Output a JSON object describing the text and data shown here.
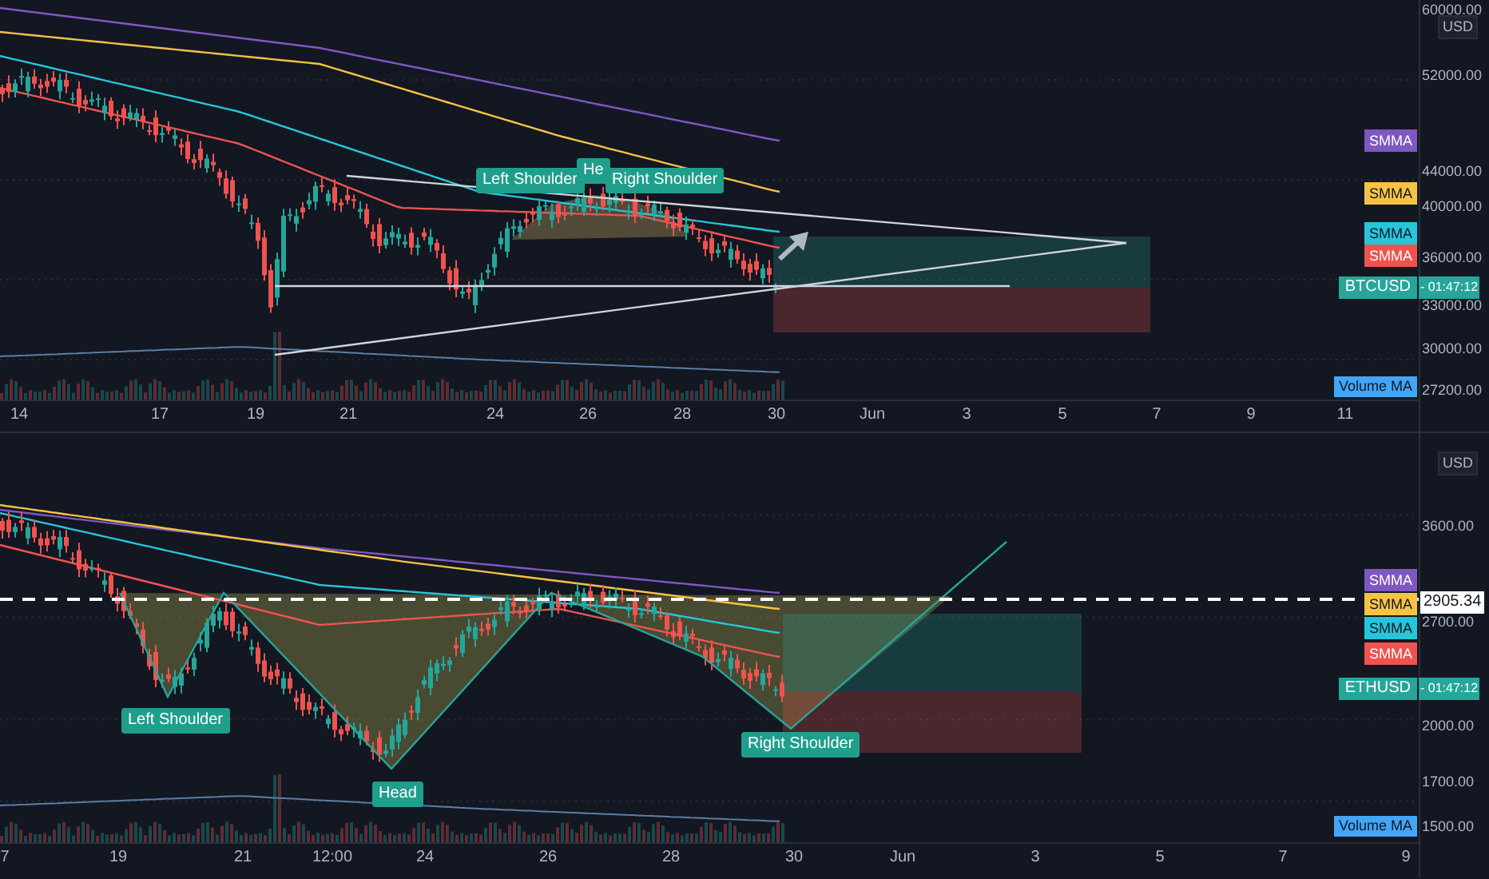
{
  "panes": [
    {
      "symbol": "BTCUSD",
      "countdown": "- 01:47:12",
      "currency": "USD",
      "price_labels": [
        "60000.00",
        "52000.00",
        "44000.00",
        "40000.00",
        "36000.00",
        "33000.00",
        "30000.00",
        "27200.00"
      ],
      "indicator_tags": [
        {
          "label": "SMMA",
          "color": "#7e57c2"
        },
        {
          "label": "SMMA",
          "color": "#f6c343"
        },
        {
          "label": "SMMA",
          "color": "#26c6da"
        },
        {
          "label": "SMMA",
          "color": "#ef5350"
        }
      ],
      "volume_tag": "Volume MA",
      "annotations": [
        "Left Shoulder",
        "He",
        "Right Shoulder"
      ],
      "time_labels": [
        "14",
        "17",
        "19",
        "21",
        "24",
        "26",
        "28",
        "30",
        "Jun",
        "3",
        "5",
        "7",
        "9",
        "11"
      ]
    },
    {
      "symbol": "ETHUSD",
      "countdown": "- 01:47:12",
      "currency": "USD",
      "current_price": "2905.34",
      "price_labels": [
        "3600.00",
        "2700.00",
        "2000.00",
        "1700.00",
        "1500.00"
      ],
      "indicator_tags": [
        {
          "label": "SMMA",
          "color": "#7e57c2"
        },
        {
          "label": "SMMA",
          "color": "#f6c343"
        },
        {
          "label": "SMMA",
          "color": "#26c6da"
        },
        {
          "label": "SMMA",
          "color": "#ef5350"
        }
      ],
      "volume_tag": "Volume MA",
      "annotations": [
        "Left Shoulder",
        "Head",
        "Right Shoulder"
      ],
      "time_labels": [
        "7",
        "19",
        "21",
        "12:00",
        "24",
        "26",
        "28",
        "30",
        "Jun",
        "3",
        "5",
        "7",
        "9"
      ]
    }
  ]
}
